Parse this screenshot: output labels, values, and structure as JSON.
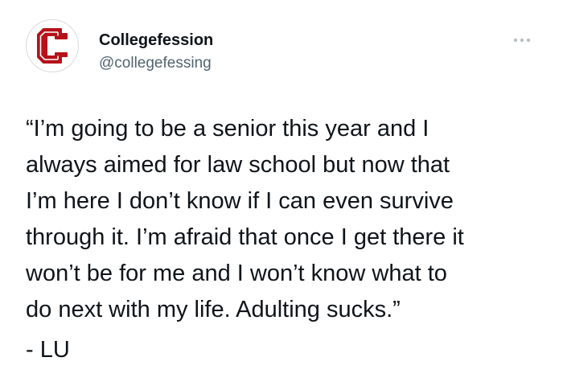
{
  "account": {
    "display_name": "Collegefession",
    "handle": "@collegefessing",
    "avatar_logo": {
      "letter": "C",
      "icon": "college-c-logo",
      "color": "#b5121b"
    }
  },
  "more_icon": "ellipsis-icon",
  "post": {
    "lines": [
      "“I’m going to be a senior this year and I",
      "always aimed for law school but now that",
      "I’m here I don’t know if I can even survive",
      "through it. I’m afraid that once I get there it",
      "won’t be for me and I won’t know what to",
      "do next with my life. Adulting sucks.”"
    ],
    "signature": "- LU"
  },
  "colors": {
    "text_primary": "#0f1419",
    "text_secondary": "#536471",
    "icon_gray": "#b8bfc6",
    "accent_red": "#b5121b"
  }
}
